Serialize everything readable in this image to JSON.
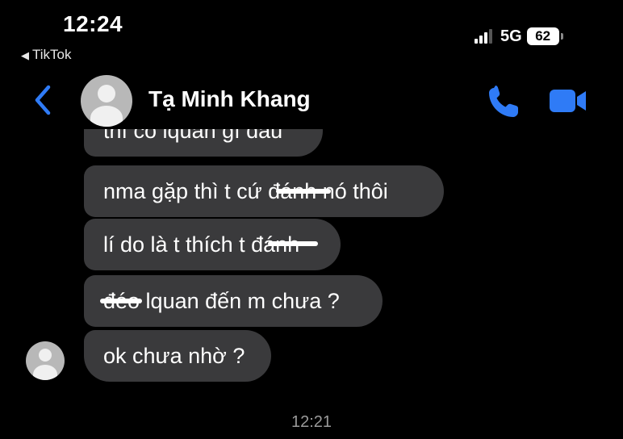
{
  "status_bar": {
    "time": "12:24",
    "back_app": "TikTok",
    "network": "5G",
    "battery": "62"
  },
  "header": {
    "contact_name": "Tạ Minh Khang",
    "accent_color": "#2f7bf6"
  },
  "messages": [
    {
      "text": "thì có lquan gì đâu"
    },
    {
      "text": "nma gặp thì t cứ đánh nó thôi"
    },
    {
      "text": "lí do là t thích t đánh"
    },
    {
      "text": "đéo lquan đến m chưa ?"
    },
    {
      "text": "ok chưa nhờ ?"
    }
  ],
  "timestamp": "12:21"
}
